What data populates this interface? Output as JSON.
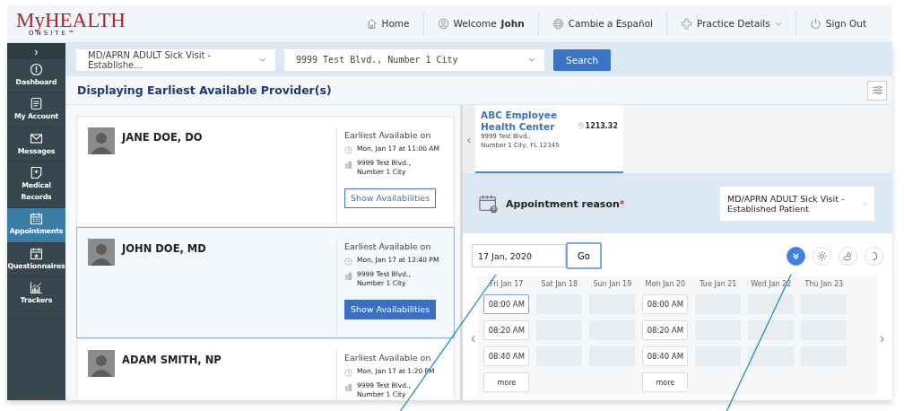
{
  "logo": {
    "line1": "MyHEALTH",
    "line2": "ONSITE℠"
  },
  "nav": [
    {
      "kind": "home",
      "label": "Home"
    },
    {
      "kind": "user",
      "label": "Welcome",
      "name": "John"
    },
    {
      "kind": "globe",
      "label": "Cambie a Español"
    },
    {
      "kind": "cross",
      "label": "Practice Details",
      "dropdown": true
    },
    {
      "kind": "power",
      "label": "Sign Out"
    }
  ],
  "sidebar": {
    "toggle": "›",
    "items": [
      {
        "kind": "dashboard",
        "label": "Dashboard",
        "selected": false
      },
      {
        "kind": "account",
        "label": "My Account",
        "selected": false
      },
      {
        "kind": "messages",
        "label": "Messages",
        "selected": false
      },
      {
        "kind": "records",
        "label": "Medical Records",
        "selected": false
      },
      {
        "kind": "calendar",
        "label": "Appointments",
        "selected": true
      },
      {
        "kind": "questionnaires",
        "label": "Questionnaires",
        "selected": false
      },
      {
        "kind": "trackers",
        "label": "Trackers",
        "selected": false
      }
    ]
  },
  "search_bar": {
    "reason_select": "MD/APRN ADULT Sick Visit - Establishe...",
    "location_select": "9999 Test Blvd., Number 1 City",
    "button": "Search"
  },
  "title": "Displaying Earliest Available Provider(s)",
  "providers": [
    {
      "name": "JANE DOE, DO",
      "earliest_label": "Earliest Available on",
      "datetime": "Mon, Jan 17 at 11:00 AM",
      "address": [
        "9999 Test Blvd.,",
        "Number 1 City"
      ],
      "button": "Show Availabilities",
      "selected": false
    },
    {
      "name": "JOHN DOE, MD",
      "earliest_label": "Earliest Available on",
      "datetime": "Mon, Jan 17 at 12:40 PM",
      "address": [
        "9999 Test Blvd.,",
        "Number 1 City"
      ],
      "button": "Show Availabilities",
      "selected": true
    },
    {
      "name": "ADAM SMITH, NP",
      "earliest_label": "Earliest Available on",
      "datetime": "Mon, Jan 17 at 1:20 PM",
      "address": [
        "9999 Test Blvd.,",
        "Number 1 City"
      ],
      "selected": false
    }
  ],
  "location_carousel": {
    "prev": "‹",
    "locations": [
      {
        "name": "ABC Employee Health Center",
        "distance": "1213.32",
        "address": [
          "9999 Test Blvd.,",
          "Number 1 City, FL 12345"
        ],
        "selected": true
      }
    ]
  },
  "appointment_reason": {
    "label": "Appointment reason",
    "required_mark": "*",
    "value": "MD/APRN ADULT Sick Visit - Established Patient"
  },
  "date_field": {
    "value": "17 Jan, 2020",
    "button": "Go"
  },
  "time_filters": [
    {
      "kind": "all",
      "selected": true
    },
    {
      "kind": "morning",
      "selected": false
    },
    {
      "kind": "afternoon",
      "selected": false
    },
    {
      "kind": "evening",
      "selected": false
    }
  ],
  "calendar": {
    "prev": "‹",
    "next": "›",
    "days": [
      {
        "label": "Fri Jan 17",
        "slots": [
          {
            "time": "08:00 AM",
            "selected": true
          },
          {
            "time": "08:20 AM",
            "selected": false
          },
          {
            "time": "08:40 AM",
            "selected": false
          }
        ],
        "more": "more"
      },
      {
        "label": "Sat Jan 18"
      },
      {
        "label": "Sun Jan 19"
      },
      {
        "label": "Mon Jan 20",
        "slots": [
          {
            "time": "08:00 AM",
            "selected": false
          },
          {
            "time": "08:20 AM",
            "selected": false
          },
          {
            "time": "08:40 AM",
            "selected": false
          }
        ],
        "more": "more"
      },
      {
        "label": "Tue Jan 21"
      },
      {
        "label": "Wed Jan 22"
      },
      {
        "label": "Thu Jan 23"
      }
    ]
  }
}
